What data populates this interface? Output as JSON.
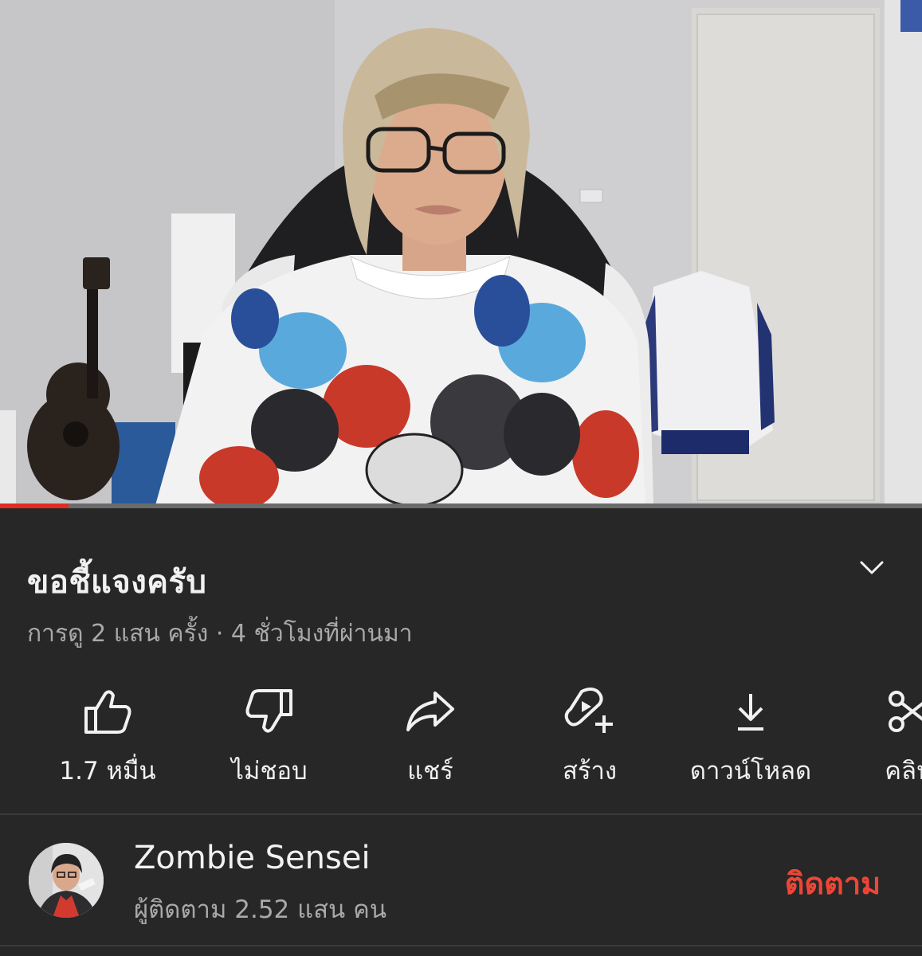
{
  "video": {
    "progress_fraction": 0.074,
    "buffered_fraction": 0.0
  },
  "title": "ขอชี้แจงครับ",
  "meta": "การดู 2 แสน ครั้ง · 4 ชั่วโมงที่ผ่านมา",
  "actions": [
    {
      "icon": "thumbs-up-icon",
      "label": "1.7 หมื่น"
    },
    {
      "icon": "thumbs-down-icon",
      "label": "ไม่ชอบ"
    },
    {
      "icon": "share-icon",
      "label": "แชร์"
    },
    {
      "icon": "create-icon",
      "label": "สร้าง"
    },
    {
      "icon": "download-icon",
      "label": "ดาวน์โหลด"
    },
    {
      "icon": "clip-icon",
      "label": "คลิป"
    }
  ],
  "channel": {
    "name": "Zombie Sensei",
    "subscribers": "ผู้ติดตาม 2.52 แสน คน",
    "subscribe_label": "ติดตาม"
  },
  "colors": {
    "background": "#272727",
    "accent": "#ef4537",
    "progress": "#e32b22",
    "secondary_text": "#a9a9a9"
  }
}
